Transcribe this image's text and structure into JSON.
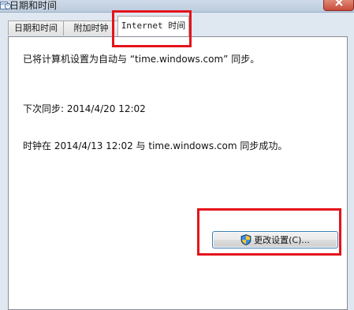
{
  "window": {
    "title": "日期和时间",
    "app_icon": "calendar-clock-icon",
    "close_icon": "close-icon"
  },
  "tabs": [
    {
      "label": "日期和时间"
    },
    {
      "label": "附加时钟"
    },
    {
      "label": "Internet 时间",
      "active": true
    }
  ],
  "panel": {
    "sync_info": "已将计算机设置为自动与 “time.windows.com” 同步。",
    "next_sync": "下次同步: 2014/4/20 12:02",
    "last_sync": "时钟在 2014/4/13 12:02 与 time.windows.com 同步成功。",
    "change_button_label": "更改设置(C)...",
    "change_button_icon": "uac-shield-icon"
  },
  "annotations": {
    "highlight_color": "#e4141b"
  },
  "colors": {
    "titlebar": "#c6d4e4",
    "panel_background": "#ffffff",
    "button_border": "#3c7fb1"
  }
}
